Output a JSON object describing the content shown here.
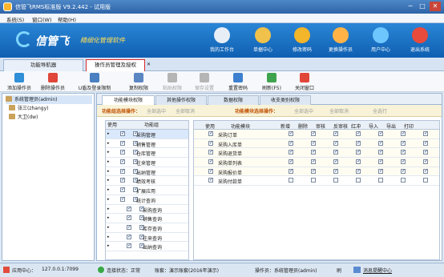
{
  "titlebar": {
    "title": "信管飞RMS标准版 V9.2.442 - 试用版",
    "min": "─",
    "max": "□",
    "close": "✕"
  },
  "menu": [
    "系统(S)",
    "窗口(W)",
    "帮助(H)"
  ],
  "banner": {
    "logo": "信管飞",
    "slogan": "精细化管理软件",
    "nav": [
      {
        "label": "我的工作台",
        "icon": "monitor-icon",
        "color": "#e8eef6"
      },
      {
        "label": "单据中心",
        "icon": "documents-icon",
        "color": "#f0c14b"
      },
      {
        "label": "修改密码",
        "icon": "lock-icon",
        "color": "#f3b52a"
      },
      {
        "label": "更换操作员",
        "icon": "users-icon",
        "color": "#ffb347"
      },
      {
        "label": "用户中心",
        "icon": "globe-icon",
        "color": "#6ec6ff"
      },
      {
        "label": "退出系统",
        "icon": "power-icon",
        "color": "#e84a3c"
      }
    ]
  },
  "doc_tabs": [
    {
      "label": "功能导航器"
    },
    {
      "label": "操作员管理及授权"
    }
  ],
  "doc_tab_close": "✕",
  "toolbar": [
    {
      "label": "添加操作员",
      "icon": "add-user-icon",
      "color": "#2f8fd8",
      "enabled": true
    },
    {
      "label": "删除操作员",
      "icon": "delete-icon",
      "color": "#e0463a",
      "enabled": true
    },
    {
      "label": "U盾及登录限制",
      "icon": "usb-key-icon",
      "color": "#4a7fc1",
      "enabled": true
    },
    {
      "label": "复制权限",
      "icon": "copy-icon",
      "color": "#5a86c2",
      "enabled": true
    },
    {
      "label": "粘贴权限",
      "icon": "paste-icon",
      "color": "#b5b5b5",
      "enabled": false
    },
    {
      "label": "保存设置",
      "icon": "save-icon",
      "color": "#b5b5b5",
      "enabled": false
    },
    {
      "label": "重置密码",
      "icon": "reset-password-icon",
      "color": "#3d7fcf",
      "enabled": true
    },
    {
      "label": "刷新(F5)",
      "icon": "refresh-icon",
      "color": "#3fa34d",
      "enabled": true
    },
    {
      "label": "关闭窗口",
      "icon": "close-window-icon",
      "color": "#e0463a",
      "enabled": true
    }
  ],
  "users": [
    {
      "label": "系统管理员(admin)"
    },
    {
      "label": "张三(zhangy)"
    },
    {
      "label": "大卫(dw)"
    }
  ],
  "inner_tabs": [
    "功能模块权限",
    "其他操作权限",
    "数据权限",
    "收支类别权限"
  ],
  "selbar": {
    "group_label": "功能组选择操作：",
    "group_all": "全部选中",
    "group_cancel": "全部取消",
    "module_label": "功能模块选择操作：",
    "module_all": "全部选中",
    "module_cancel": "全部取消",
    "run": "全选行"
  },
  "left_grid": {
    "headers": [
      "使用",
      "功能组"
    ],
    "rows": [
      {
        "name": "采购管理",
        "checked": true,
        "indent": 0,
        "selected": true
      },
      {
        "name": "销售管理",
        "checked": true,
        "indent": 0
      },
      {
        "name": "仓库管理",
        "checked": true,
        "indent": 0
      },
      {
        "name": "往来管理",
        "checked": true,
        "indent": 0
      },
      {
        "name": "出纳管理",
        "checked": true,
        "indent": 0
      },
      {
        "name": "绩效考核",
        "checked": true,
        "indent": 0
      },
      {
        "name": "扩展应用",
        "checked": true,
        "indent": 0
      },
      {
        "name": "统计查询",
        "checked": true,
        "indent": 0
      },
      {
        "name": "采购查询",
        "checked": true,
        "indent": 1
      },
      {
        "name": "销售查询",
        "checked": true,
        "indent": 1
      },
      {
        "name": "库存查询",
        "checked": true,
        "indent": 1
      },
      {
        "name": "往来查询",
        "checked": true,
        "indent": 1
      },
      {
        "name": "出纳查询",
        "checked": true,
        "indent": 1
      }
    ]
  },
  "right_grid": {
    "headers": [
      "使用",
      "功能模块",
      "新增",
      "删除",
      "审核",
      "反审核",
      "红冲",
      "导入",
      "导出",
      "打印"
    ],
    "rows": [
      {
        "name": "采购订单",
        "use": true,
        "perms": [
          true,
          true,
          true,
          true,
          true,
          true,
          true,
          true
        ]
      },
      {
        "name": "采购入库单",
        "use": true,
        "perms": [
          true,
          true,
          true,
          true,
          true,
          true,
          true,
          true
        ]
      },
      {
        "name": "采购退货单",
        "use": true,
        "perms": [
          true,
          true,
          true,
          true,
          true,
          true,
          true,
          true
        ]
      },
      {
        "name": "采购单列表",
        "use": true,
        "perms": [
          true,
          true,
          true,
          true,
          true,
          true,
          true,
          true
        ]
      },
      {
        "name": "采购报价单",
        "use": true,
        "perms": [
          true,
          true,
          true,
          true,
          true,
          true,
          true,
          true
        ]
      },
      {
        "name": "采购付款单",
        "use": true,
        "perms": [
          false,
          false,
          false,
          false,
          false,
          false,
          false,
          false
        ]
      }
    ]
  },
  "status": {
    "center": "应用中心：",
    "center_ip": "127.0.0.1:7099",
    "conn": "连接状态：正常",
    "account": "账套：演示账套(2016年演示)",
    "operator": "操作员：系统管理员(admin)",
    "flag": "刷",
    "msg": "消息提醒中心"
  }
}
